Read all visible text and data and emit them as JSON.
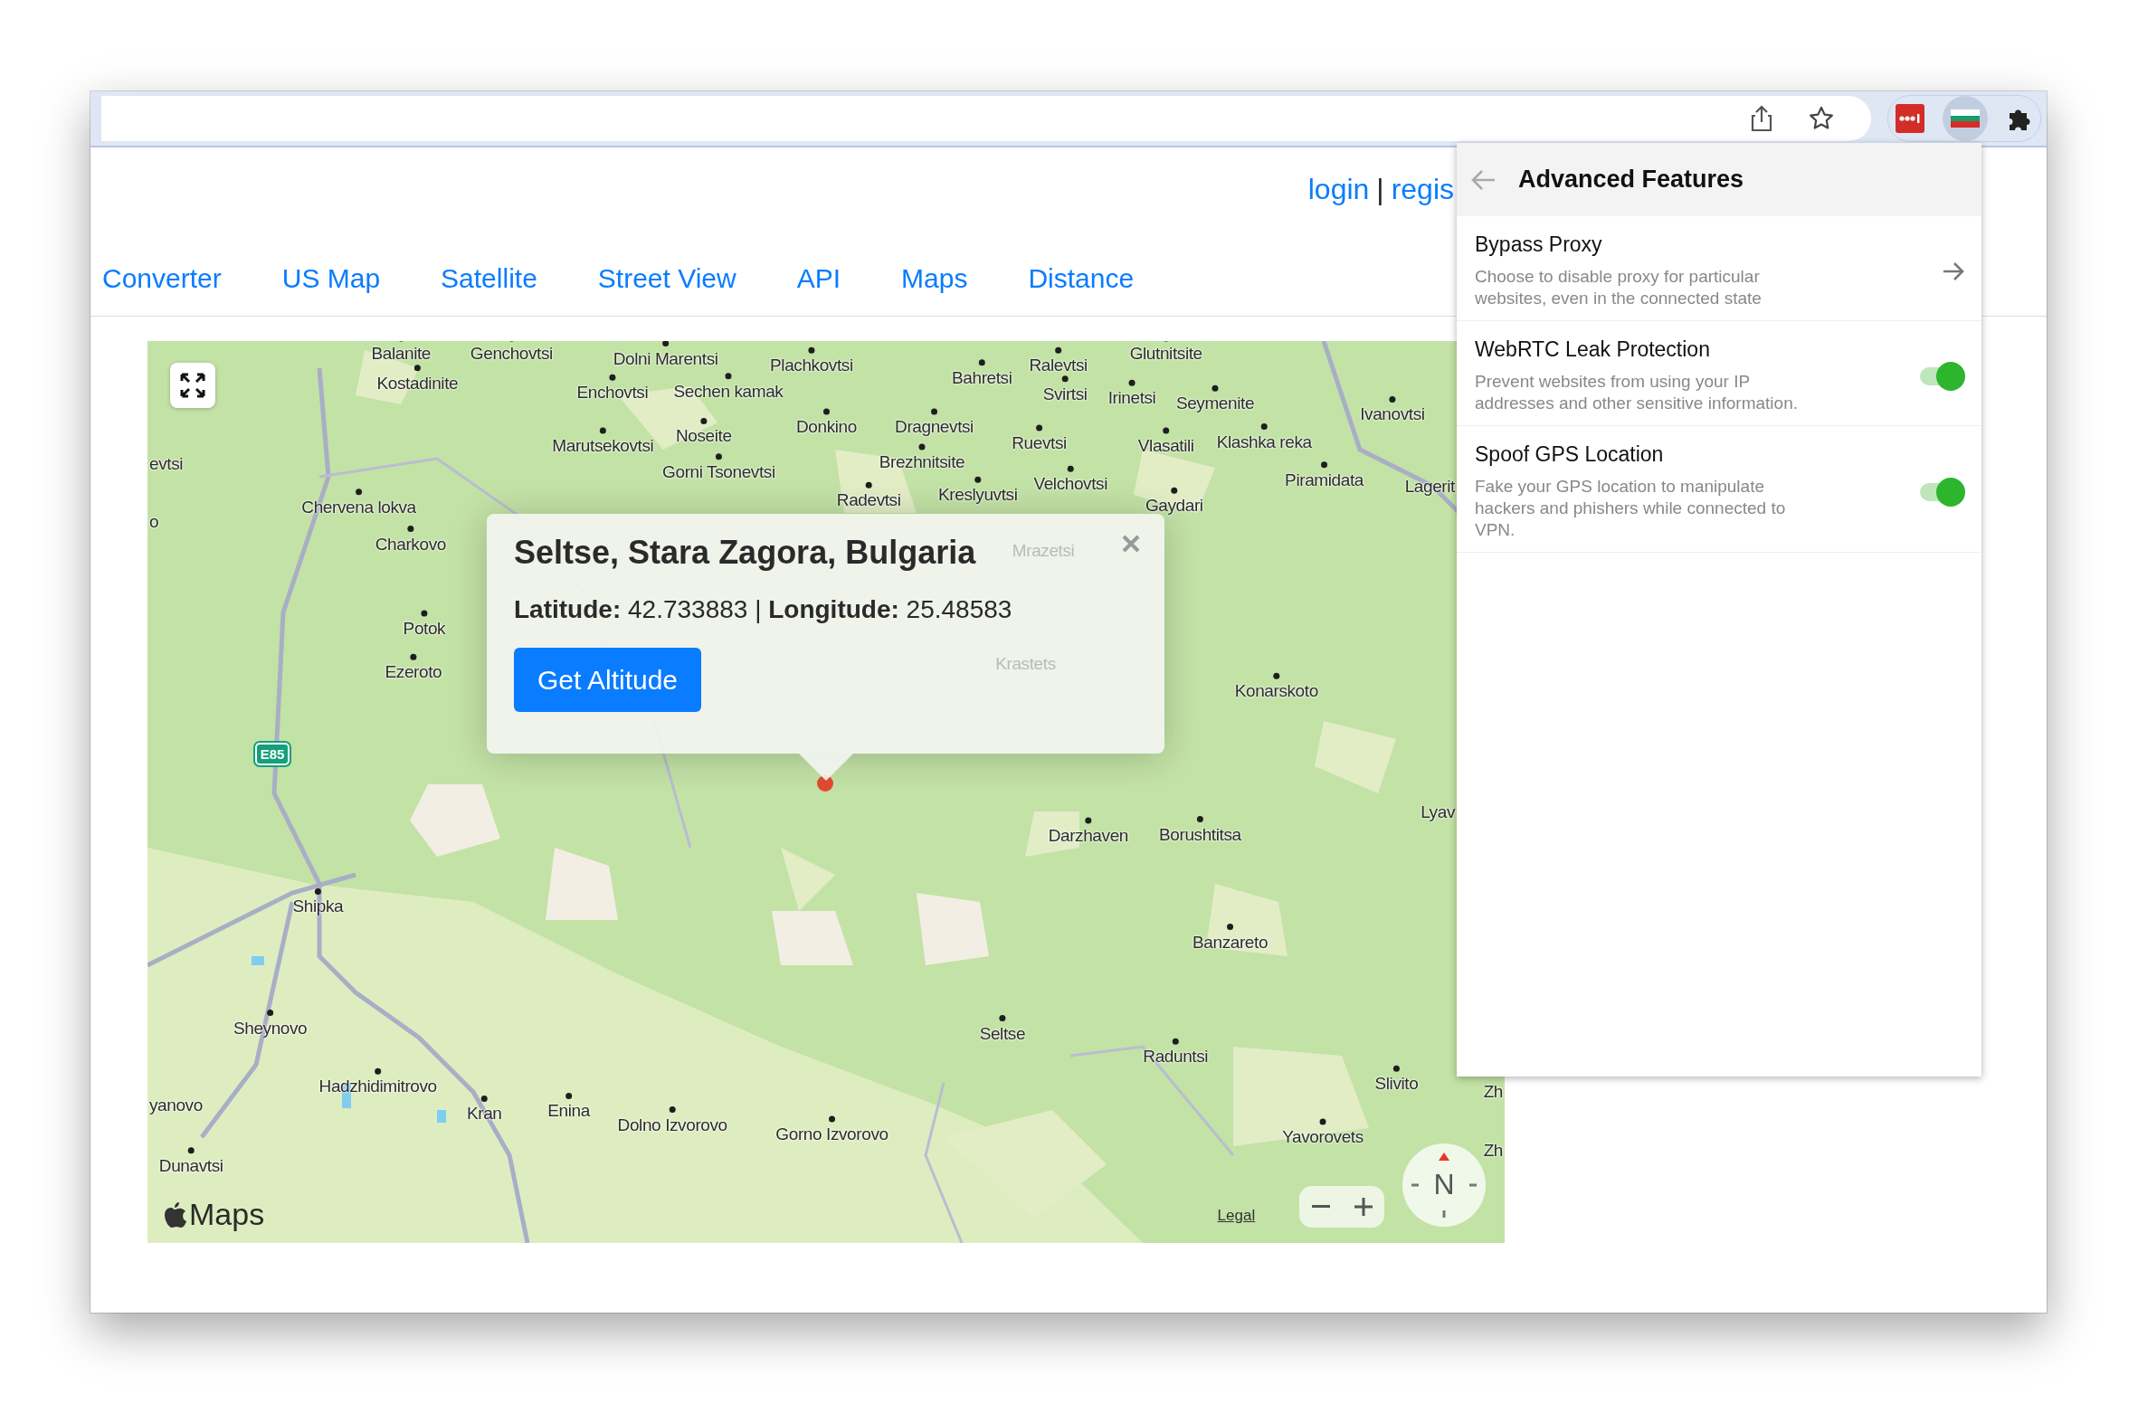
{
  "header": {
    "login": "login",
    "separator": "|",
    "register": "regis"
  },
  "nav": [
    "Converter",
    "US Map",
    "Satellite",
    "Street View",
    "API",
    "Maps",
    "Distance"
  ],
  "map": {
    "places": [
      "Balanite",
      "Genchovtsi",
      "Kostadinite",
      "Dolni Marentsi",
      "Plachkovtsi",
      "Enchovtsi",
      "Sechen kamak",
      "Bahretsi",
      "Ralevtsi",
      "Glutnitsite",
      "Svirtsi",
      "Irinetsi",
      "Seymenite",
      "Ivanovtsi",
      "evtsi",
      "Marutsekovtsi",
      "Noseite",
      "Donkino",
      "Dragnevtsi",
      "Ruevtsi",
      "Vlasatili",
      "Klashka reka",
      "Gorni Tsonevtsi",
      "Brezhnitsite",
      "Velchovtsi",
      "Piramidata",
      "Lagerit",
      "Chervena lokva",
      "Radevtsi",
      "Kreslyuvtsi",
      "Gaydari",
      "o",
      "Charkovo",
      "Mrazetsi",
      "Potok",
      "Ezeroto",
      "Krastets",
      "Konarskoto",
      "Lyav",
      "Darzhaven",
      "Borushtitsa",
      "Shipka",
      "Banzareto",
      "Sheynovo",
      "Seltse",
      "Raduntsi",
      "Hadzhidimitrovo",
      "Slivito",
      "Zh",
      "yanovo",
      "Kran",
      "Enina",
      "Dolno Izvorovo",
      "Gorno Izvorovo",
      "Yavorovets",
      "Zh",
      "Dunavtsi"
    ],
    "road_shield": "E85",
    "info_popup": {
      "title": "Seltse, Stara Zagora, Bulgaria",
      "coordinates": "**Latitude:** 42.733883 | **Longitude:** 25.48583",
      "button": "Get Altitude"
    },
    "attribution": "Maps",
    "legal": "Legal",
    "compass": "N"
  },
  "extension_popup": {
    "title": "Advanced Features",
    "items": [
      {
        "kind": "link",
        "title": "Bypass Proxy",
        "description": "Choose to disable proxy for particular websites, even in the connected state"
      },
      {
        "kind": "toggle",
        "title": "WebRTC Leak Protection",
        "description": "Prevent websites from using your IP addresses and other sensitive information.",
        "on": true
      },
      {
        "kind": "toggle",
        "title": "Spoof GPS Location",
        "description": "Fake your GPS location to manipulate hackers and phishers while connected to VPN.",
        "on": true
      }
    ]
  }
}
